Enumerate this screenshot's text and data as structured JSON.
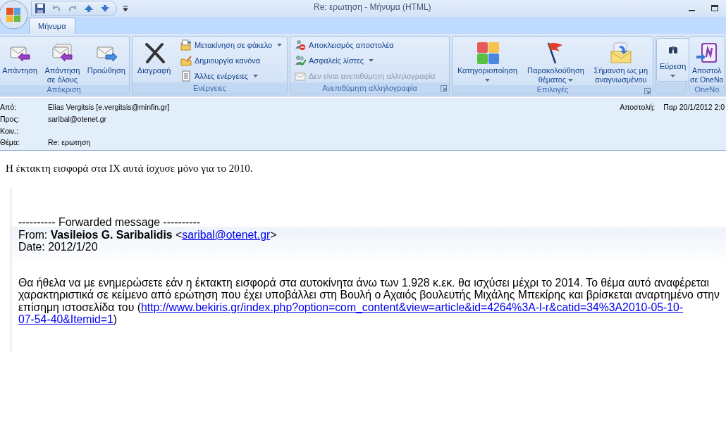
{
  "window": {
    "title": "Re: ερωτηση - Μήνυμα (HTML)"
  },
  "tabs": [
    {
      "label": "Μήνυμα",
      "selected": true
    }
  ],
  "ribbon": {
    "groups": [
      {
        "label": "Απόκριση",
        "launcher": false,
        "items": [
          {
            "kind": "large",
            "label": "Απάντηση",
            "menu": false,
            "disabled": false
          },
          {
            "kind": "large",
            "label": "Απάντηση\nσε όλους",
            "menu": false,
            "disabled": false
          },
          {
            "kind": "large",
            "label": "Προώθηση",
            "menu": false,
            "disabled": false
          }
        ]
      },
      {
        "label": "Ενέργειες",
        "launcher": false,
        "items": [
          {
            "kind": "large",
            "label": "Διαγραφή",
            "menu": false,
            "disabled": false
          },
          {
            "kind": "small",
            "label": "Μετακίνηση σε φάκελο",
            "menu": true,
            "disabled": false
          },
          {
            "kind": "small",
            "label": "Δημιουργία κανόνα",
            "menu": false,
            "disabled": false
          },
          {
            "kind": "small",
            "label": "Άλλες ενέργειες",
            "menu": true,
            "disabled": false
          }
        ]
      },
      {
        "label": "Ανεπιθύμητη αλληλογραφία",
        "launcher": true,
        "items": [
          {
            "kind": "small",
            "label": "Αποκλεισμός αποστολέα",
            "menu": false,
            "disabled": false
          },
          {
            "kind": "small",
            "label": "Ασφαλείς λίστες",
            "menu": true,
            "disabled": false
          },
          {
            "kind": "small",
            "label": "Δεν είναι ανεπιθύμητη αλληλογραφία",
            "menu": false,
            "disabled": true
          }
        ]
      },
      {
        "label": "Επιλογές",
        "launcher": true,
        "items": [
          {
            "kind": "large",
            "label": "Κατηγοριοποίηση",
            "menu": true,
            "disabled": false
          },
          {
            "kind": "large",
            "label": "Παρακολούθηση\nθέματος",
            "menu": true,
            "disabled": false
          },
          {
            "kind": "large",
            "label": "Σήμανση ως μη\nαναγνωσμένου",
            "menu": false,
            "disabled": false
          }
        ]
      },
      {
        "launcher": false,
        "items": [
          {
            "kind": "large",
            "label": "Εύρεση",
            "menu": true,
            "disabled": false
          }
        ]
      },
      {
        "label": "OneNo",
        "launcher": false,
        "items": [
          {
            "kind": "large",
            "label": "Αποστολ\nσε OneNo",
            "menu": false,
            "disabled": false
          }
        ]
      }
    ]
  },
  "header": {
    "fields": [
      {
        "label": "Από:",
        "value": "Elias Vergitsis [e.vergitsis@minfin.gr]"
      },
      {
        "label": "Προς:",
        "value": "saribal@otenet.gr"
      },
      {
        "label": "Κοιν.:"
      },
      {
        "label": "Θέμα:",
        "value": "Re: ερωτηση"
      }
    ],
    "sent": {
      "label": "Αποστολή:",
      "value": "Παρ 20/1/2012 2:0"
    }
  },
  "body": {
    "reply_text": "Η έκτακτη εισφορά στα ΙΧ αυτά ίσχυσε μόνο για το 2010.",
    "quote": {
      "separator": "---------- Forwarded message ----------",
      "from": {
        "before": "From: **Vasileios G. Saribalidis** <",
        "link": "saribal@otenet.gr",
        "after": ">"
      },
      "date": "Date: 2012/1/20",
      "paragraph": {
        "text": "Θα ήθελα να με ενημερώσετε εάν η έκτακτη εισφορά στα αυτοκίνητα άνω των 1.928 κ.εκ. θα ισχύσει μέχρι το 2014. Το θέμα αυτό αναφέρεται χαρακτηριστικά σε κείμενο από ερώτηση που έχει υποβάλλει στη Βουλή ο Αχαιός βουλευτής Μιχάλης Μπεκίρης και βρίσκεται αναρτημένο στην επίσημη ιστοσελίδα του (",
        "link": [
          "http://www.bekiris.gr/index.php?option=com_content&view=article&id=4264%3A-l-r&catid=34%3A2010-05-10-",
          "07-54-40&Itemid=1"
        ],
        "after": ")"
      }
    }
  }
}
